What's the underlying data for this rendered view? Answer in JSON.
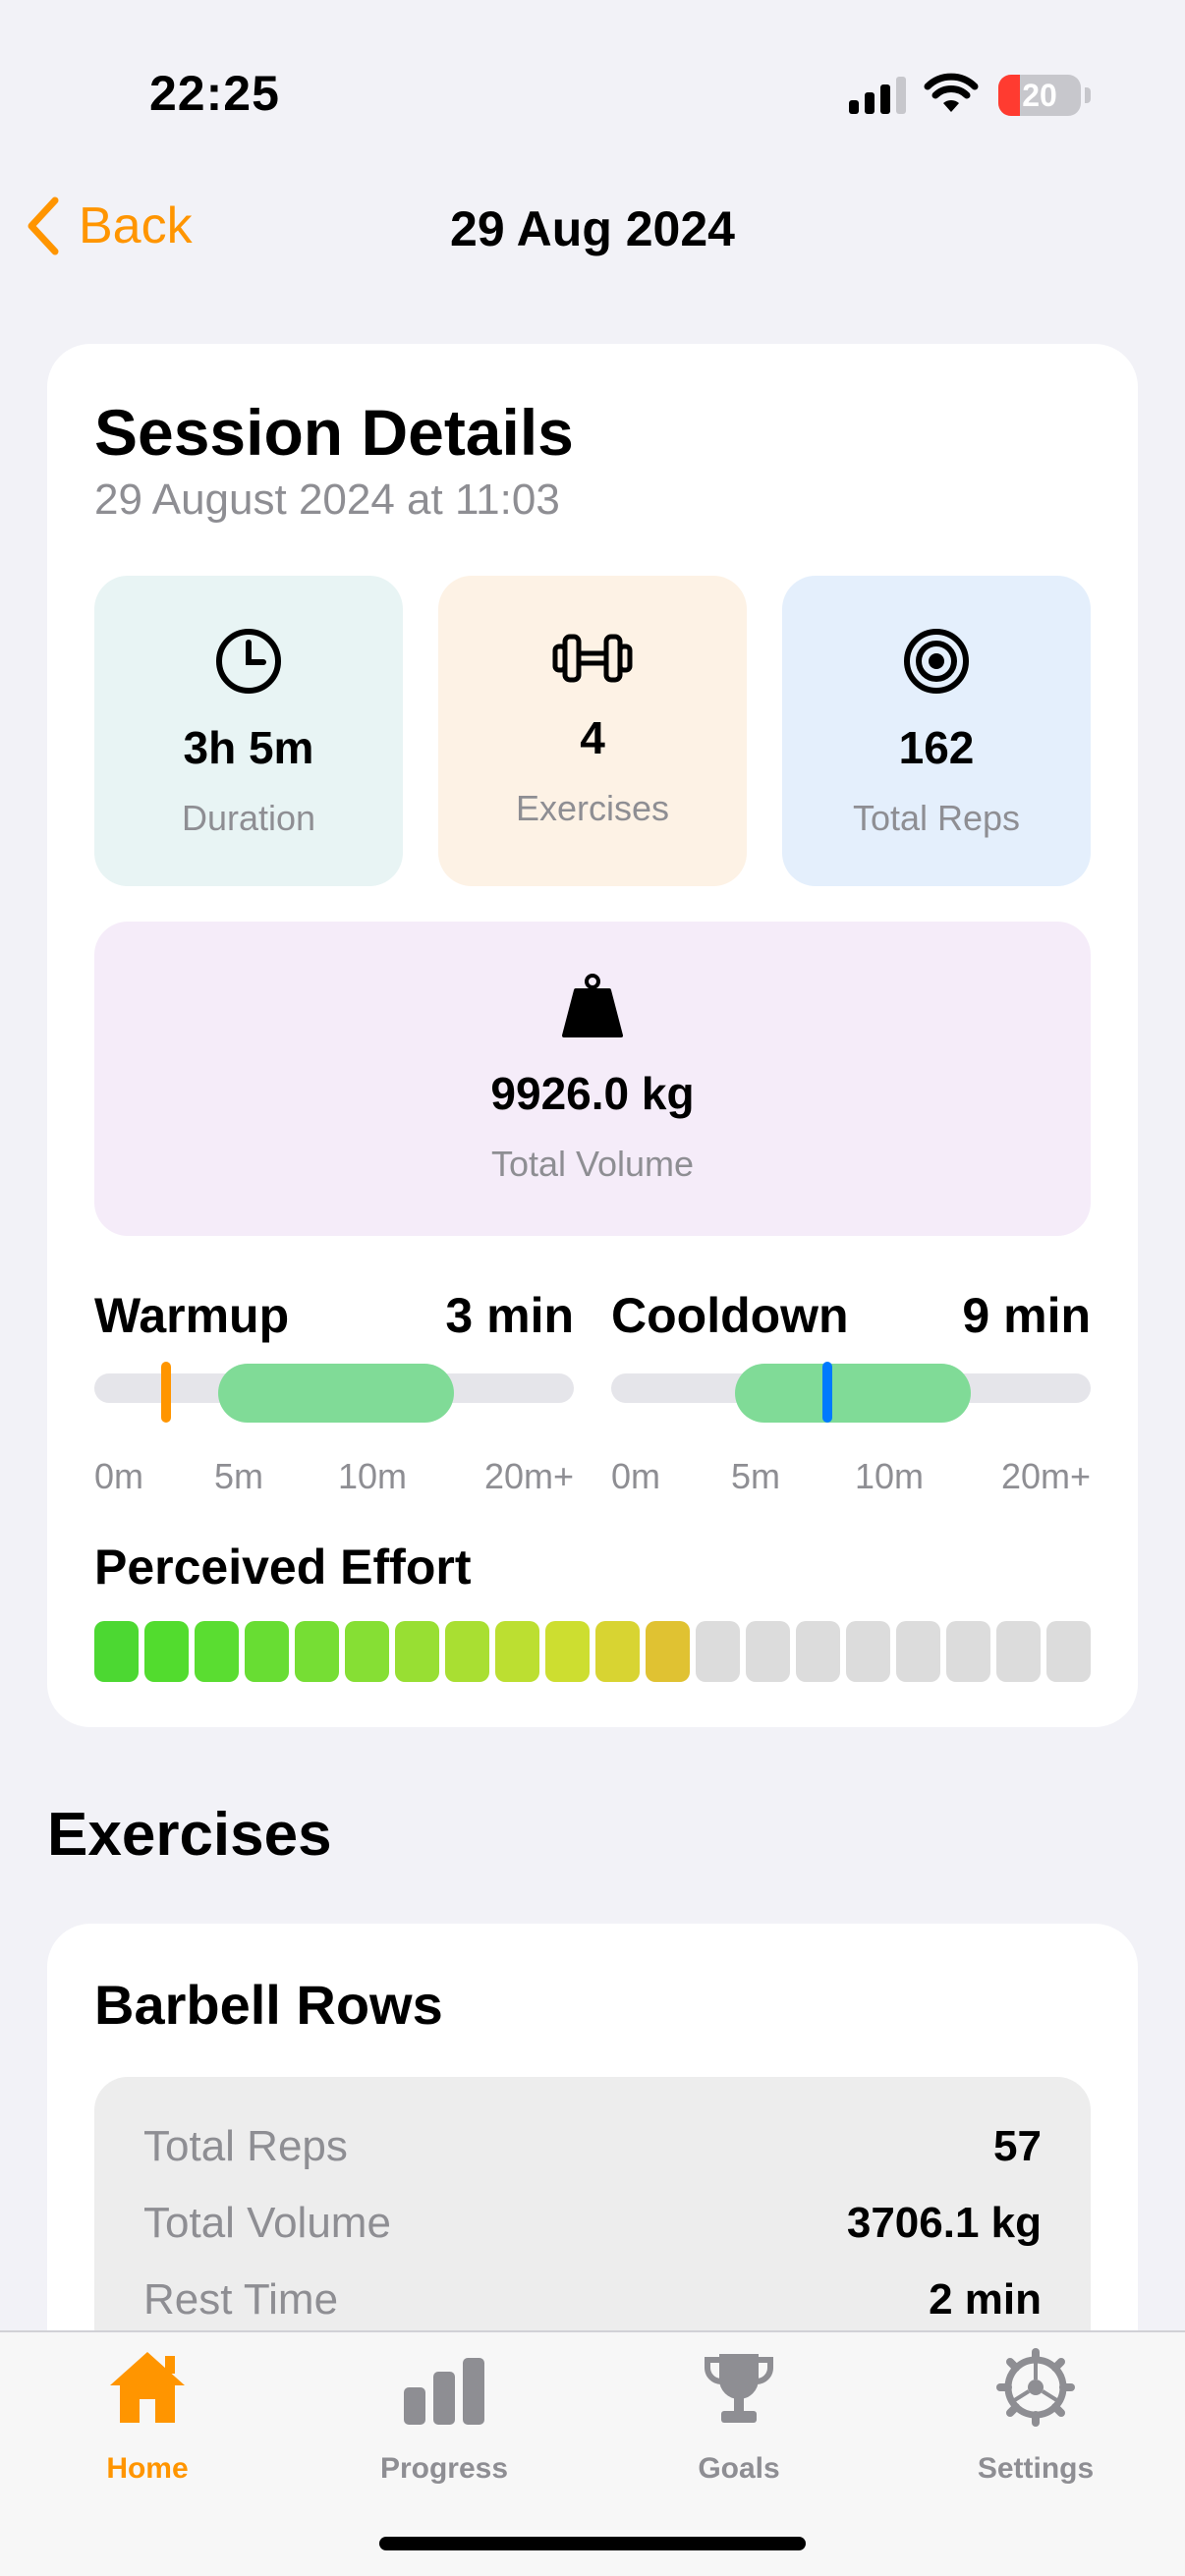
{
  "status_bar": {
    "time": "22:25",
    "battery": "20"
  },
  "nav": {
    "back_label": "Back",
    "title": "29 Aug 2024"
  },
  "session": {
    "title": "Session Details",
    "subtitle": "29 August 2024 at 11:03",
    "duration": {
      "value": "3h 5m",
      "label": "Duration",
      "icon": "clock-icon"
    },
    "exercises": {
      "value": "4",
      "label": "Exercises",
      "icon": "dumbbell-icon"
    },
    "reps": {
      "value": "162",
      "label": "Total Reps",
      "icon": "target-icon"
    },
    "volume": {
      "value": "9926.0 kg",
      "label": "Total Volume",
      "icon": "weight-icon"
    },
    "warmup": {
      "label": "Warmup",
      "value": "3 min",
      "ticks": [
        "0m",
        "5m",
        "10m",
        "20m+"
      ],
      "range_minutes": [
        5,
        15
      ],
      "actual_minutes": 3,
      "marker_color": "#ff9500"
    },
    "cooldown": {
      "label": "Cooldown",
      "value": "9 min",
      "ticks": [
        "0m",
        "5m",
        "10m",
        "20m+"
      ],
      "range_minutes": [
        5,
        15
      ],
      "actual_minutes": 9,
      "marker_color": "#007aff"
    },
    "effort": {
      "label": "Perceived Effort",
      "filled": 12,
      "total": 20
    }
  },
  "exercises_section": {
    "title": "Exercises",
    "items": [
      {
        "name": "Barbell Rows",
        "stats": [
          {
            "label": "Total Reps",
            "value": "57"
          },
          {
            "label": "Total Volume",
            "value": "3706.1 kg"
          },
          {
            "label": "Rest Time",
            "value": "2 min"
          }
        ]
      }
    ]
  },
  "tabs": [
    {
      "label": "Home",
      "icon": "home-icon",
      "active": true
    },
    {
      "label": "Progress",
      "icon": "bar-chart-icon",
      "active": false
    },
    {
      "label": "Goals",
      "icon": "trophy-icon",
      "active": false
    },
    {
      "label": "Settings",
      "icon": "gear-icon",
      "active": false
    }
  ],
  "colors": {
    "accent": "#ff9500",
    "range": "#80db97",
    "track": "#e5e5ea",
    "empty": "#dcdcdc"
  }
}
